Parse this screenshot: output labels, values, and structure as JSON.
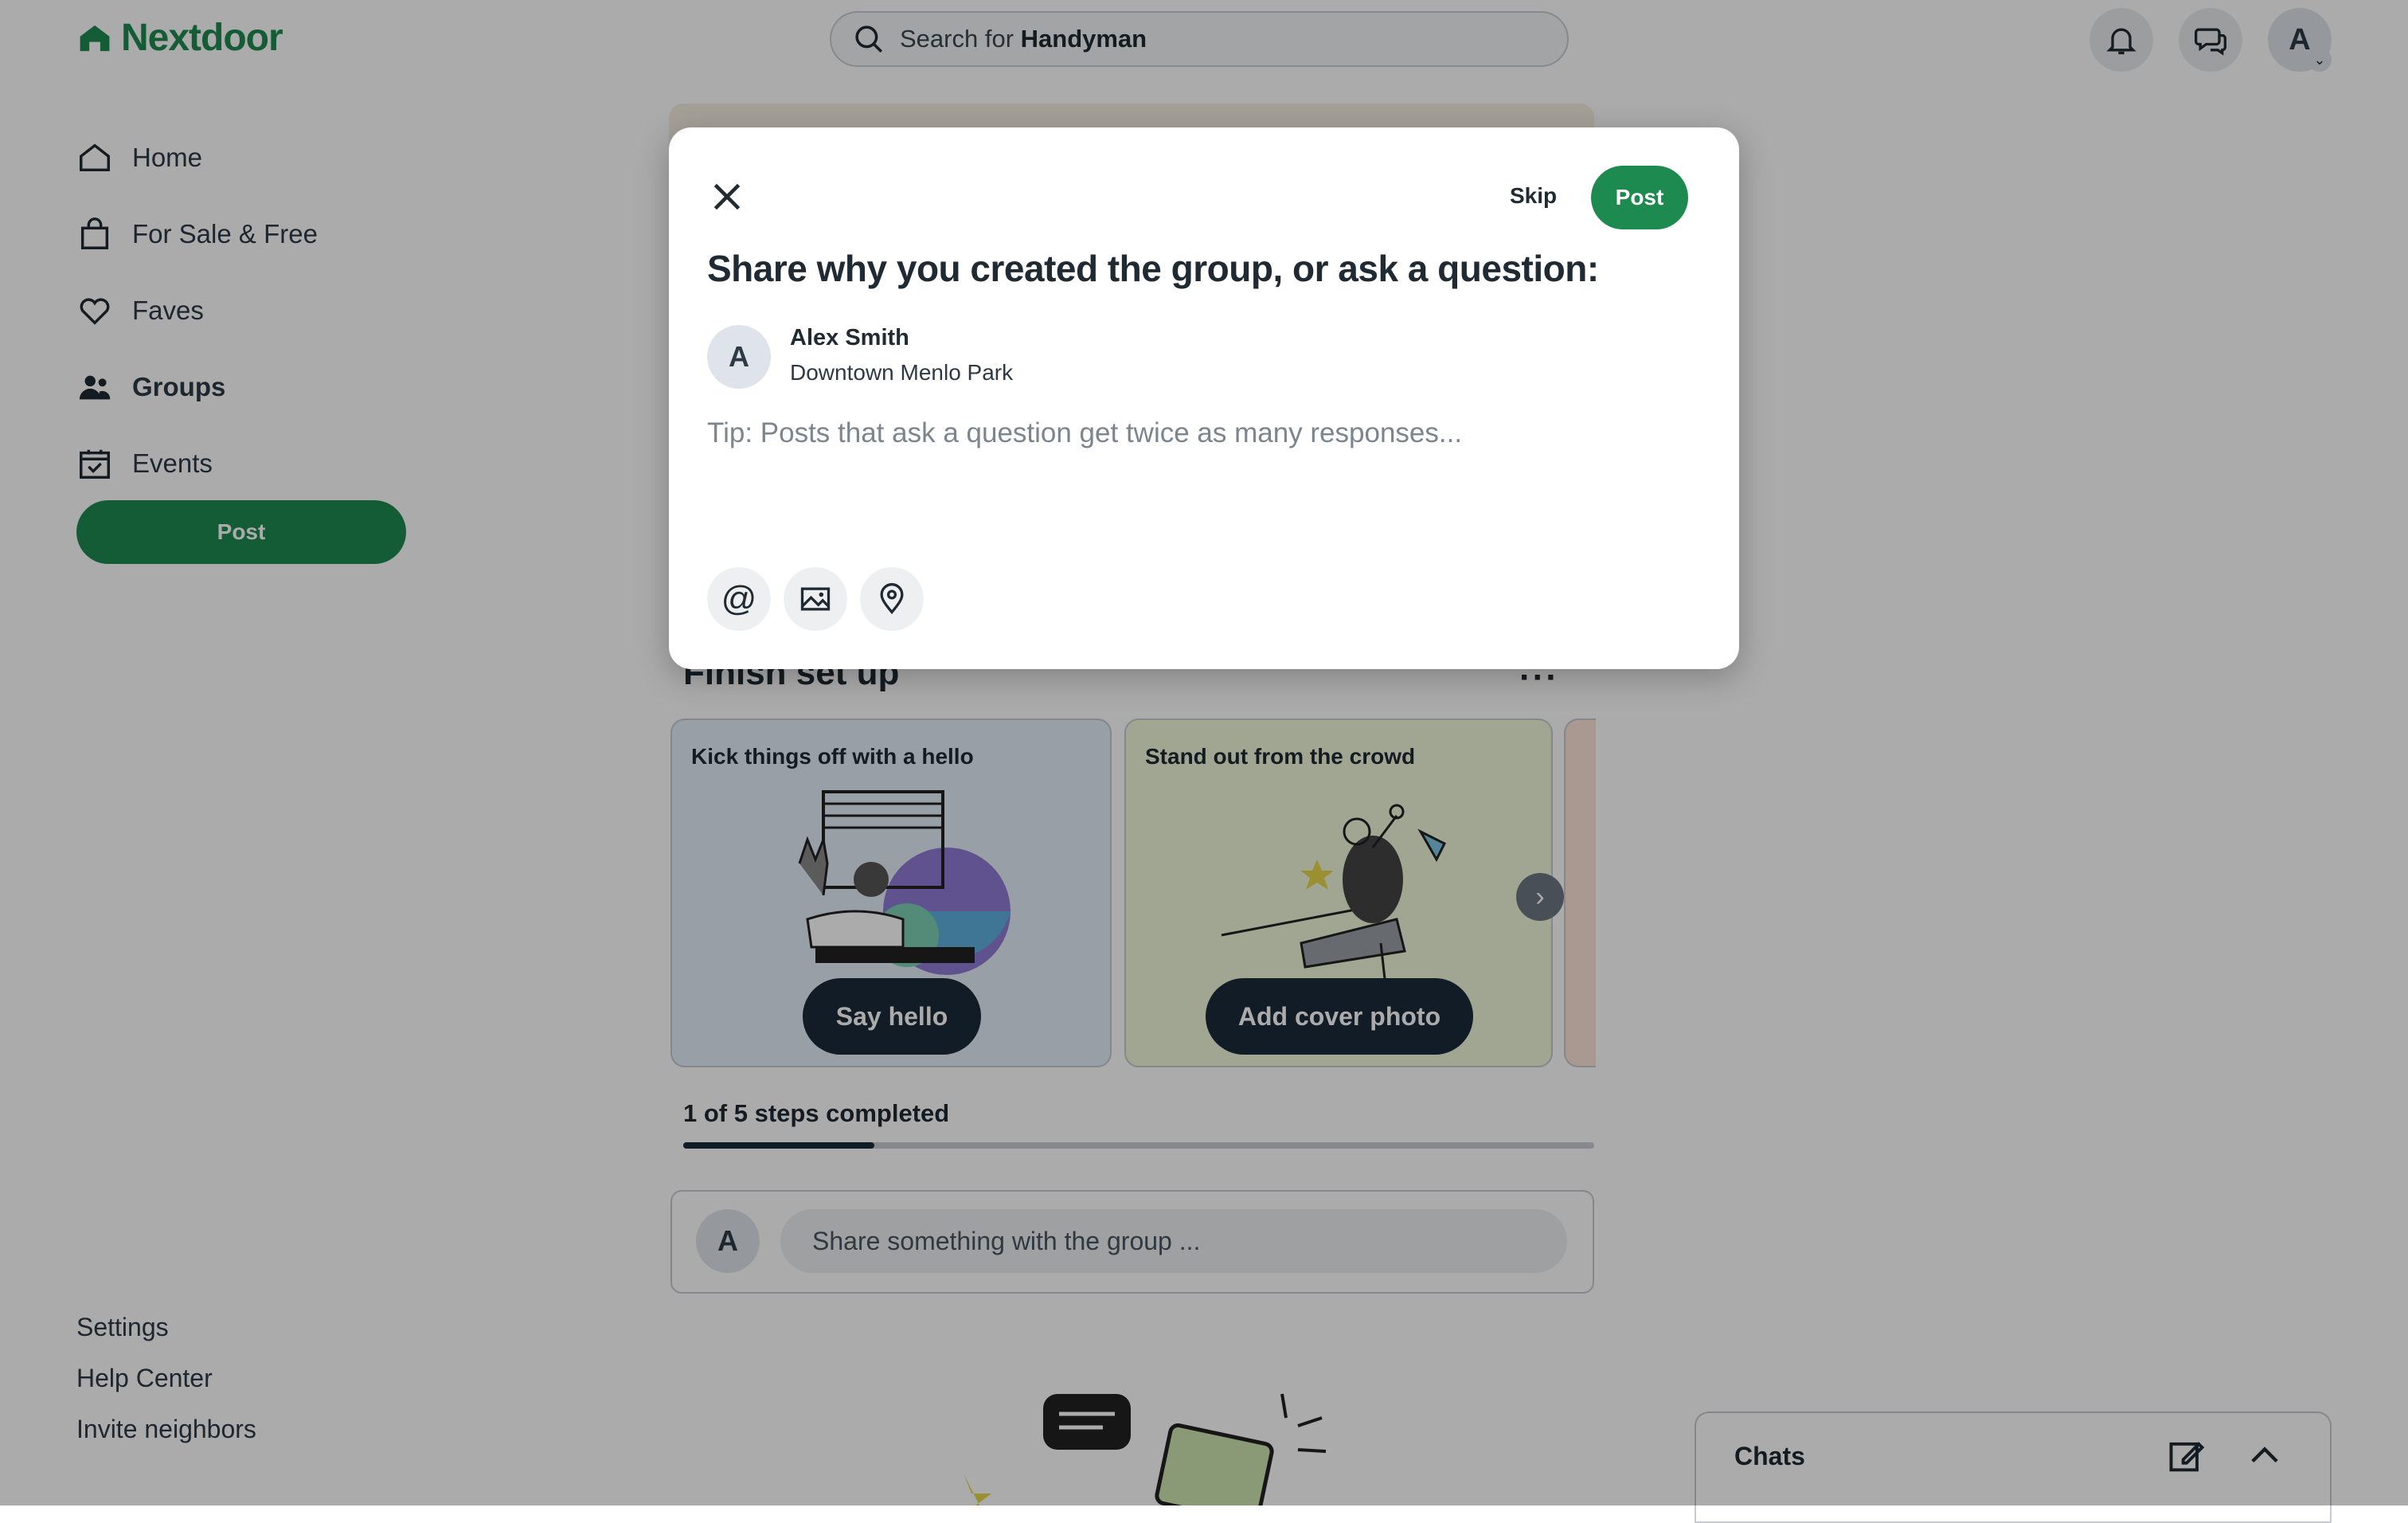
{
  "header": {
    "logo_text": "Nextdoor",
    "search_prefix": "Search for",
    "search_term": "Handyman",
    "avatar_initial": "A"
  },
  "sidebar": {
    "items": [
      {
        "label": "Home",
        "icon": "home-icon"
      },
      {
        "label": "For Sale & Free",
        "icon": "shopping-bag-icon"
      },
      {
        "label": "Faves",
        "icon": "heart-icon"
      },
      {
        "label": "Groups",
        "icon": "people-icon",
        "active": true
      },
      {
        "label": "Events",
        "icon": "calendar-icon"
      }
    ],
    "post_label": "Post",
    "footer": [
      "Settings",
      "Help Center",
      "Invite neighbors"
    ]
  },
  "setup": {
    "title": "Finish set up",
    "cards": [
      {
        "title": "Kick things off with a hello",
        "button": "Say hello"
      },
      {
        "title": "Stand out from the crowd",
        "button": "Add cover photo"
      }
    ],
    "steps_text": "1 of 5 steps completed",
    "progress": 0.21
  },
  "composer": {
    "avatar_initial": "A",
    "placeholder": "Share something with the group ..."
  },
  "chats": {
    "label": "Chats"
  },
  "modal": {
    "skip_label": "Skip",
    "post_label": "Post",
    "heading": "Share why you created the group, or ask a question:",
    "author_initial": "A",
    "author_name": "Alex Smith",
    "author_location": "Downtown Menlo Park",
    "tip": "Tip: Posts that ask a question get twice as many responses...",
    "mention_symbol": "@"
  },
  "colors": {
    "brand_green": "#1d8a4f",
    "dark_button": "#1b2a39",
    "overlay": "rgba(0,0,0,0.33)"
  }
}
